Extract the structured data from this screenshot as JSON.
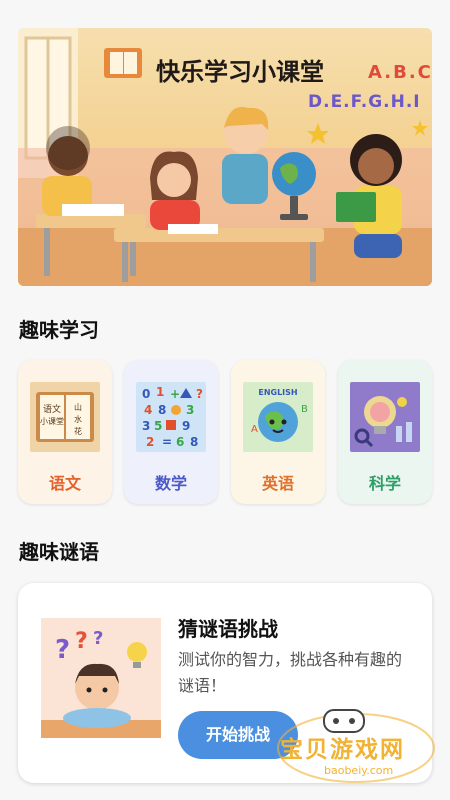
{
  "banner": {
    "title": "快乐学习小课堂",
    "letters_top": "A.B.C",
    "letters_bottom": "D.E.F.G.H.I"
  },
  "sections": {
    "fun_learning": "趣味学习",
    "fun_riddles": "趣味谜语"
  },
  "subjects": [
    {
      "label": "语文",
      "color": "#e2622c",
      "bg": "#fdf3e6",
      "book_text": "语文\n小课堂"
    },
    {
      "label": "数学",
      "color": "#4c59c8",
      "bg": "#eef0fb"
    },
    {
      "label": "英语",
      "color": "#e0702a",
      "bg": "#fdf6e6",
      "icon_text": "ENGLISH"
    },
    {
      "label": "科学",
      "color": "#2f9e68",
      "bg": "#eaf6ef"
    }
  ],
  "riddle": {
    "title": "猜谜语挑战",
    "description": "测试你的智力，挑战各种有趣的谜语！",
    "button": "开始挑战"
  },
  "watermark": {
    "text": "宝贝游戏网",
    "url": "baobeiy.com"
  },
  "colors": {
    "accent": "#4a8fe0",
    "page_bg": "#f7f7f7"
  }
}
